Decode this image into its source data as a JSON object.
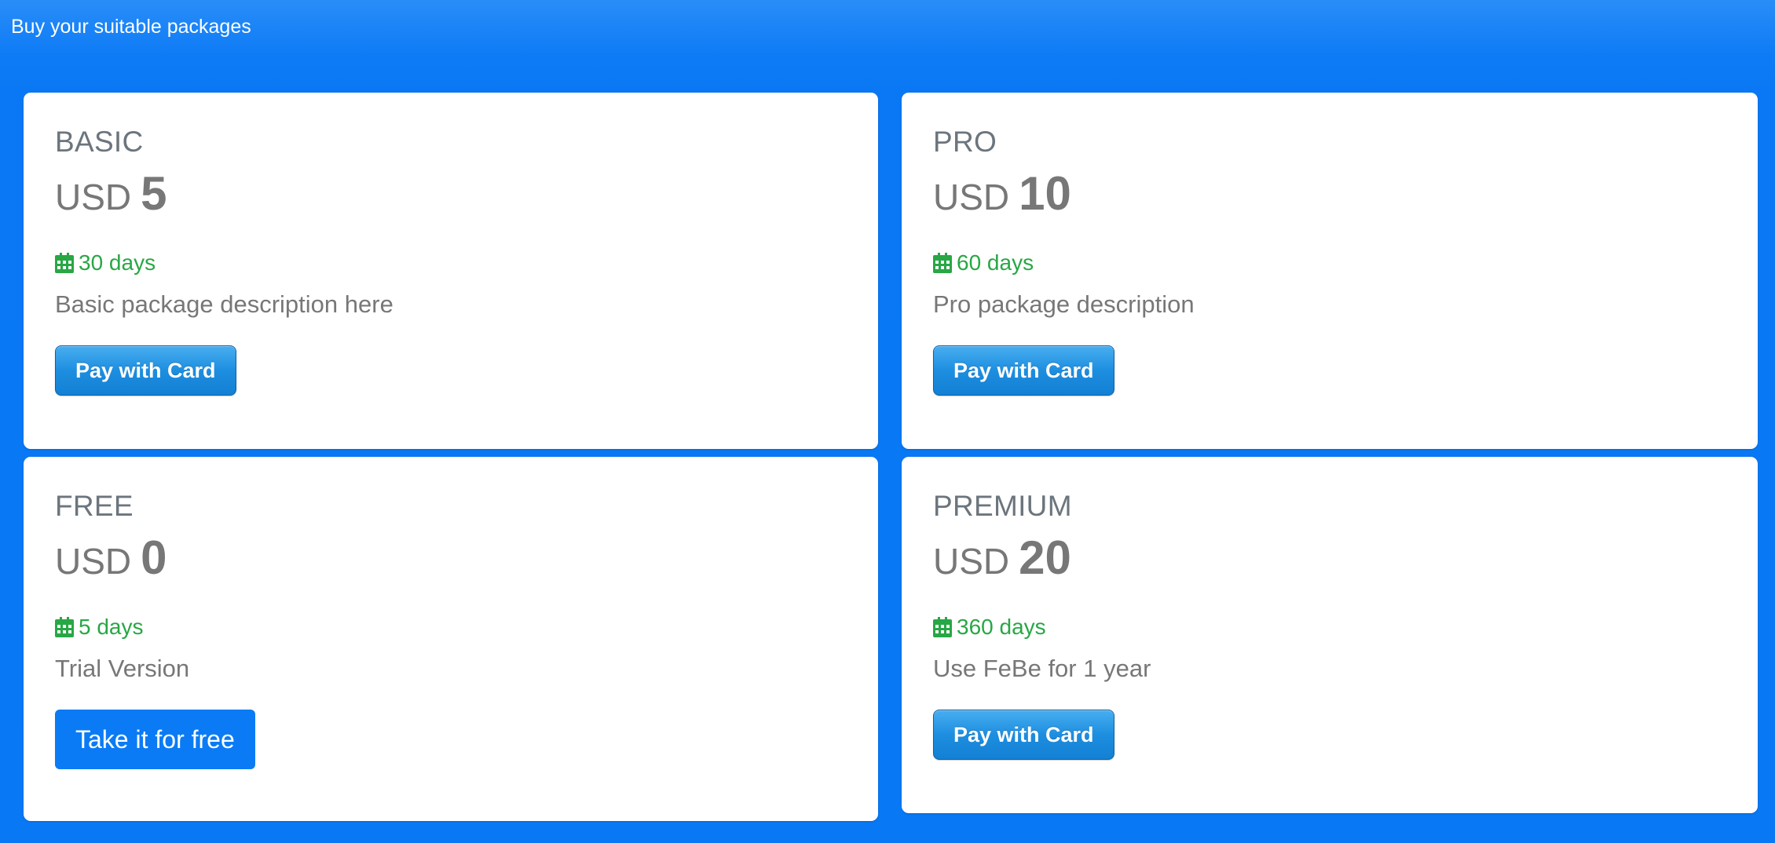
{
  "header": {
    "title": "Buy your suitable packages"
  },
  "packages": [
    {
      "name": "BASIC",
      "currency": "USD",
      "amount": "5",
      "duration": "30 days",
      "description": "Basic package description here",
      "button_label": "Pay with Card"
    },
    {
      "name": "PRO",
      "currency": "USD",
      "amount": "10",
      "duration": "60 days",
      "description": "Pro package description",
      "button_label": "Pay with Card"
    },
    {
      "name": "FREE",
      "currency": "USD",
      "amount": "0",
      "duration": "5 days",
      "description": "Trial Version",
      "button_label": "Take it for free"
    },
    {
      "name": "PREMIUM",
      "currency": "USD",
      "amount": "20",
      "duration": "360 days",
      "description": "Use FeBe for 1 year",
      "button_label": "Pay with Card"
    }
  ],
  "colors": {
    "background": "#0a7bf5",
    "duration_green": "#28a745",
    "text_gray": "#777777",
    "name_gray": "#6c757d",
    "card_button_blue": "#1d8ee0",
    "free_button_blue": "#0a7bf5"
  },
  "icons": {
    "duration": "calendar-icon"
  }
}
